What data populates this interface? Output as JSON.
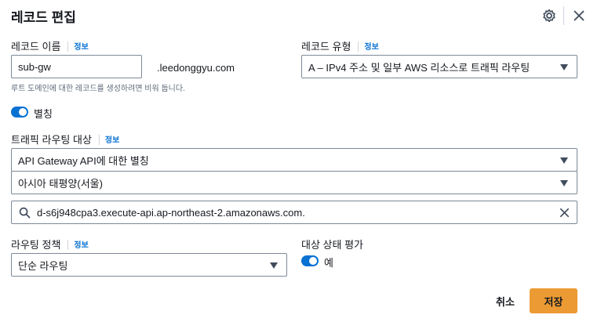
{
  "header": {
    "title": "레코드 편집",
    "settings_icon": "gear-icon",
    "close_icon": "close-icon"
  },
  "record_name": {
    "label": "레코드 이름",
    "info": "정보",
    "value": "sub-gw",
    "domain_suffix": ".leedonggyu.com",
    "hint": "루트 도메인에 대한 레코드를 생성하려면 비워 둡니다."
  },
  "record_type": {
    "label": "레코드 유형",
    "info": "정보",
    "selected": "A – IPv4 주소 및 일부 AWS 리소스로 트래픽 라우팅"
  },
  "alias": {
    "label": "별칭",
    "enabled": true
  },
  "traffic_target": {
    "label": "트래픽 라우팅 대상",
    "info": "정보",
    "endpoint_type": "API Gateway API에 대한 별칭",
    "region": "아시아 태평양(서울)",
    "endpoint": "d-s6j948cpa3.execute-api.ap-northeast-2.amazonaws.com."
  },
  "routing_policy": {
    "label": "라우팅 정책",
    "info": "정보",
    "selected": "단순 라우팅"
  },
  "health": {
    "label": "대상 상태 평가",
    "toggle_label": "예",
    "enabled": true
  },
  "footer": {
    "cancel_label": "취소",
    "save_label": "저장"
  },
  "colors": {
    "accent": "#0972d3",
    "primary_button": "#ec9b34"
  }
}
